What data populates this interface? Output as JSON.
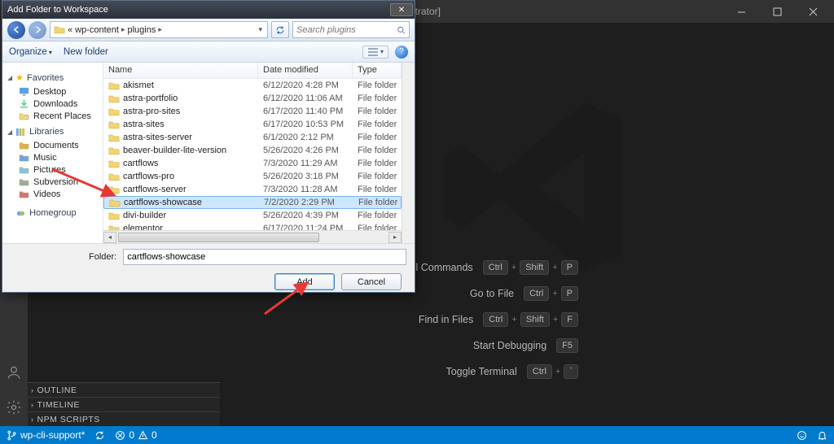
{
  "vscode": {
    "title": "- Visual Studio Code [Administrator]",
    "welcome": {
      "cmds": [
        {
          "label": "Show All Commands",
          "keys": [
            "Ctrl",
            "+",
            "Shift",
            "+",
            "P"
          ]
        },
        {
          "label": "Go to File",
          "keys": [
            "Ctrl",
            "+",
            "P"
          ]
        },
        {
          "label": "Find in Files",
          "keys": [
            "Ctrl",
            "+",
            "Shift",
            "+",
            "F"
          ]
        },
        {
          "label": "Start Debugging",
          "keys": [
            "F5"
          ]
        },
        {
          "label": "Toggle Terminal",
          "keys": [
            "Ctrl",
            "+",
            "`"
          ]
        }
      ]
    },
    "outline": [
      "OUTLINE",
      "TIMELINE",
      "NPM SCRIPTS"
    ],
    "status": {
      "branch": "wp-cli-support*",
      "sync": "",
      "errors": "0",
      "warnings": "0"
    }
  },
  "dialog": {
    "title": "Add Folder to Workspace",
    "breadcrumb": [
      "«",
      "wp-content",
      "plugins"
    ],
    "search_placeholder": "Search plugins",
    "toolbar": {
      "organize": "Organize",
      "newfolder": "New folder"
    },
    "tree": {
      "favorites": {
        "label": "Favorites",
        "items": [
          "Desktop",
          "Downloads",
          "Recent Places"
        ]
      },
      "libraries": {
        "label": "Libraries",
        "items": [
          "Documents",
          "Music",
          "Pictures",
          "Subversion",
          "Videos"
        ]
      },
      "homegroup": {
        "label": "Homegroup"
      }
    },
    "columns": {
      "name": "Name",
      "date": "Date modified",
      "type": "Type"
    },
    "rows": [
      {
        "name": "akismet",
        "date": "6/12/2020 4:28 PM",
        "type": "File folder"
      },
      {
        "name": "astra-portfolio",
        "date": "6/12/2020 11:06 AM",
        "type": "File folder"
      },
      {
        "name": "astra-pro-sites",
        "date": "6/17/2020 11:40 PM",
        "type": "File folder"
      },
      {
        "name": "astra-sites",
        "date": "6/17/2020 10:53 PM",
        "type": "File folder"
      },
      {
        "name": "astra-sites-server",
        "date": "6/1/2020 2:12 PM",
        "type": "File folder"
      },
      {
        "name": "beaver-builder-lite-version",
        "date": "5/26/2020 4:26 PM",
        "type": "File folder"
      },
      {
        "name": "cartflows",
        "date": "7/3/2020 11:29 AM",
        "type": "File folder"
      },
      {
        "name": "cartflows-pro",
        "date": "5/26/2020 3:18 PM",
        "type": "File folder"
      },
      {
        "name": "cartflows-server",
        "date": "7/3/2020 11:28 AM",
        "type": "File folder"
      },
      {
        "name": "cartflows-showcase",
        "date": "7/2/2020 2:29 PM",
        "type": "File folder",
        "selected": true
      },
      {
        "name": "divi-builder",
        "date": "5/26/2020 4:39 PM",
        "type": "File folder"
      },
      {
        "name": "elementor",
        "date": "6/17/2020 11:24 PM",
        "type": "File folder"
      }
    ],
    "folder_label": "Folder:",
    "folder_value": "cartflows-showcase",
    "buttons": {
      "add": "Add",
      "cancel": "Cancel"
    }
  }
}
